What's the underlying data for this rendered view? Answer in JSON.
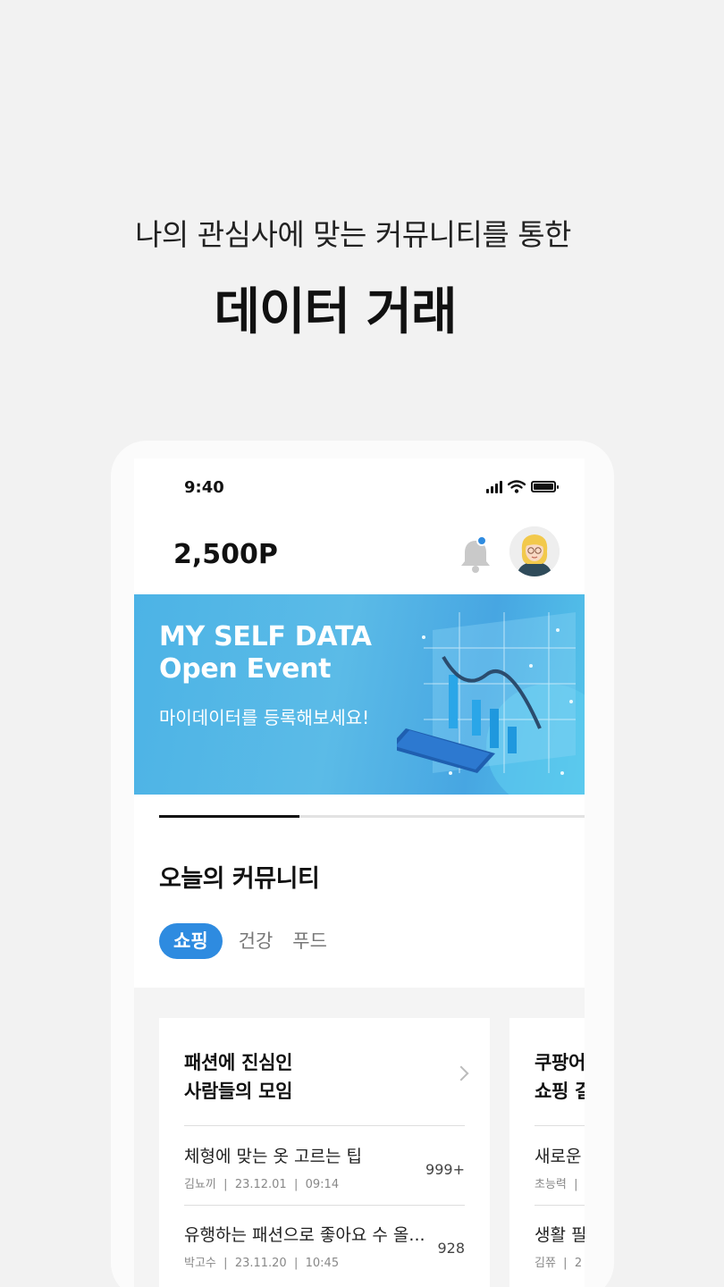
{
  "headline": {
    "subtitle": "나의 관심사에 맞는 커뮤니티를 통한",
    "title": "데이터 거래"
  },
  "status_bar": {
    "time": "9:40"
  },
  "header": {
    "points": "2,500P",
    "has_notification": true
  },
  "banner": {
    "title_line1": "MY SELF DATA",
    "title_line2": "Open Event",
    "subtitle": "마이데이터를 등록해보세요!",
    "progress": 0.33
  },
  "community": {
    "title": "오늘의 커뮤니티",
    "tabs": [
      {
        "label": "쇼핑",
        "active": true
      },
      {
        "label": "건강",
        "active": false
      },
      {
        "label": "푸드",
        "active": false
      }
    ]
  },
  "cards": [
    {
      "title_line1": "패션에 진심인",
      "title_line2": "사람들의 모임",
      "posts": [
        {
          "title": "체형에 맞는 옷 고르는 팁",
          "author": "김뇨끼",
          "date": "23.12.01",
          "time": "09:14",
          "count": "999+"
        },
        {
          "title": "유행하는 패션으로 좋아요 수 올...",
          "author": "박고수",
          "date": "23.11.20",
          "time": "10:45",
          "count": "928"
        }
      ]
    },
    {
      "title_line1": "쿠팡어",
      "title_line2": "쇼핑 걸",
      "posts": [
        {
          "title": "새로운",
          "author": "초능력",
          "date": "",
          "time": "",
          "count": ""
        },
        {
          "title": "생활 필",
          "author": "김쮸",
          "date": "2",
          "time": "",
          "count": ""
        }
      ]
    }
  ],
  "colors": {
    "accent": "#2e8be0",
    "banner": "#4cb3e6",
    "background": "#f2f2f2"
  }
}
